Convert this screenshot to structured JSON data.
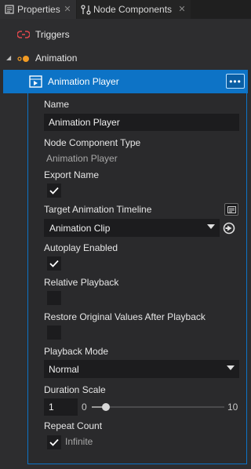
{
  "tabs": [
    {
      "label": "Properties",
      "icon": "properties-icon",
      "active": false
    },
    {
      "label": "Node Components",
      "icon": "node-components-icon",
      "active": true
    }
  ],
  "tree": {
    "triggers": {
      "label": "Triggers",
      "icon": "triggers-icon"
    },
    "animation": {
      "label": "Animation",
      "icon": "animation-icon",
      "expanded": true
    },
    "player": {
      "label": "Animation Player",
      "icon": "animation-player-icon",
      "more": "•••"
    }
  },
  "props": {
    "name_label": "Name",
    "name_value": "Animation Player",
    "type_label": "Node Component Type",
    "type_value": "Animation Player",
    "export_label": "Export Name",
    "export_checked": true,
    "timeline_label": "Target Animation Timeline",
    "timeline_value": "Animation Clip",
    "autoplay_label": "Autoplay Enabled",
    "autoplay_checked": true,
    "relative_label": "Relative Playback",
    "relative_checked": false,
    "restore_label": "Restore Original Values After Playback",
    "restore_checked": false,
    "mode_label": "Playback Mode",
    "mode_value": "Normal",
    "duration_label": "Duration Scale",
    "duration_value": "1",
    "duration_min": "0",
    "duration_max": "10",
    "repeat_label": "Repeat Count",
    "repeat_infinite_label": "Infinite",
    "repeat_infinite_checked": true
  },
  "colors": {
    "accent": "#0d73c6",
    "background": "#2a2a2c",
    "field": "#1c1c1e",
    "trigger_icon": "#e0484d",
    "animation_icon": "#f29b24"
  }
}
